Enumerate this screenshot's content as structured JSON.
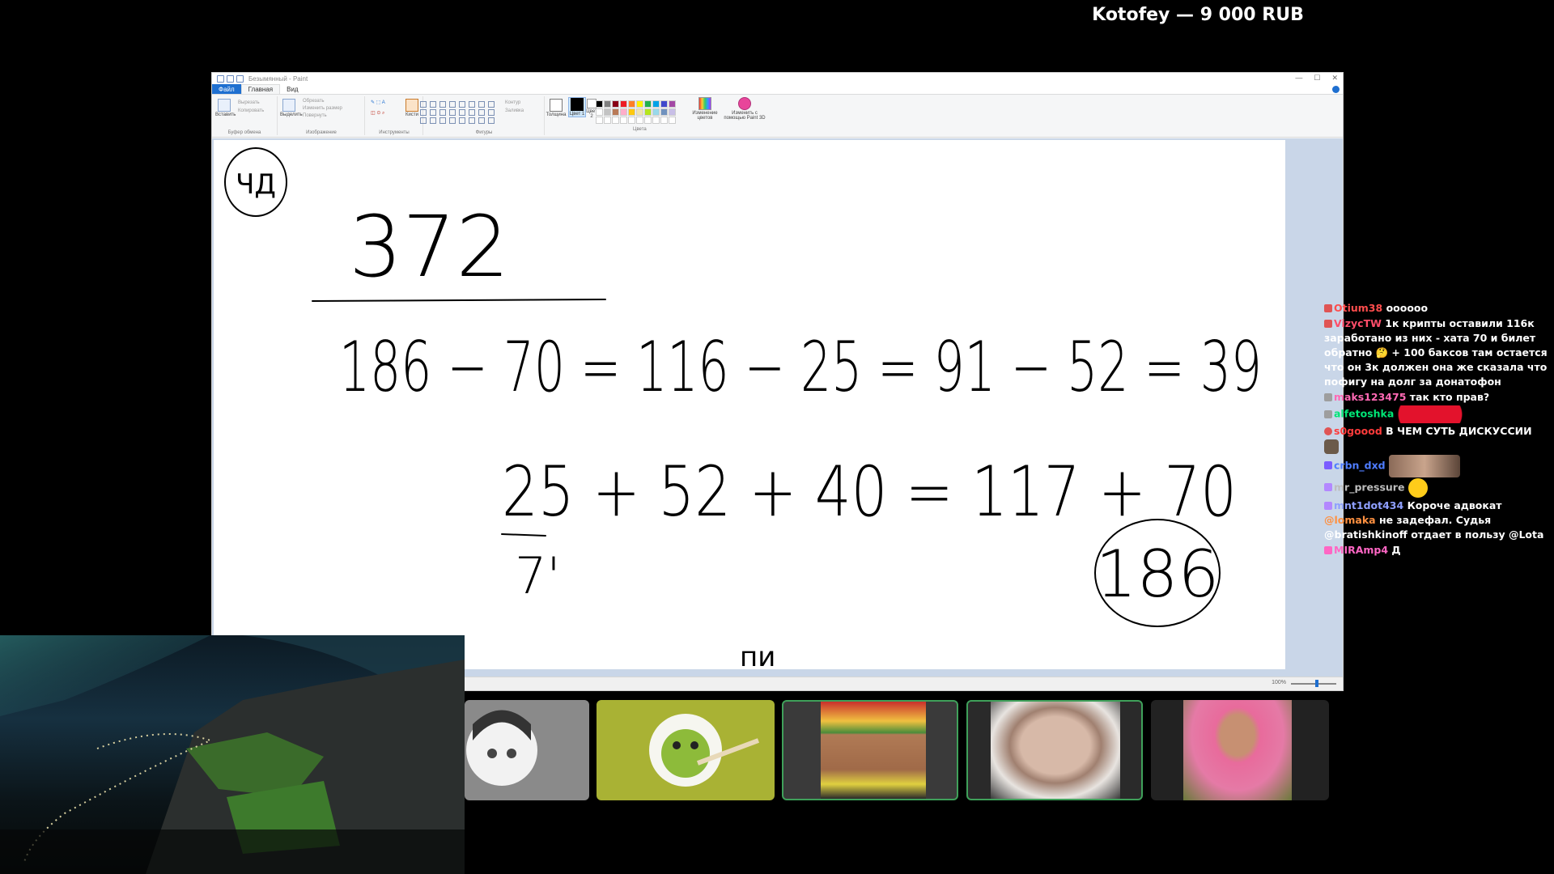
{
  "donation": {
    "text": "Kotofey — 9 000 RUB"
  },
  "paint": {
    "title": "Безымянный - Paint",
    "tabs": {
      "file": "Файл",
      "home": "Главная",
      "view": "Вид"
    },
    "ribbon": {
      "paste": "Вставить",
      "cut": "Вырезать",
      "copy": "Копировать",
      "clipboard": "Буфер обмена",
      "select": "Выделить",
      "crop": "Обрезать",
      "resize": "Изменить размер",
      "rotate": "Повернуть",
      "image": "Изображение",
      "tools": "Инструменты",
      "brushes": "Кисти",
      "shapes": "Фигуры",
      "outline": "Контур",
      "fill": "Заливка",
      "size": "Толщина",
      "color1": "Цвет 1",
      "color2": "Цвет 2",
      "colors": "Цвета",
      "edit_colors": "Изменение цветов",
      "paint3d": "Изменить с помощью Paint 3D"
    },
    "palette": [
      "#000000",
      "#7f7f7f",
      "#880015",
      "#ed1c24",
      "#ff7f27",
      "#fff200",
      "#22b14c",
      "#00a2e8",
      "#3f48cc",
      "#a349a4",
      "#ffffff",
      "#c3c3c3",
      "#b97a57",
      "#ffaec9",
      "#ffc90e",
      "#efe4b0",
      "#b5e61d",
      "#99d9ea",
      "#7092be",
      "#c8bfe7",
      "#ffffff",
      "#ffffff",
      "#ffffff",
      "#ffffff",
      "#ffffff",
      "#ffffff",
      "#ffffff",
      "#ffffff",
      "#ffffff",
      "#ffffff"
    ],
    "zoom": "100%",
    "drawing": {
      "circled_top": "ЧД",
      "numerator": "372",
      "equation1": "186 − 70 = 116 − 25 = 91 − 52 = 39",
      "equation2": "25 + 52 + 40 = 117 + 70",
      "circled_result": "186",
      "under_25": "7'",
      "bottom_text": "пи"
    }
  },
  "chat": {
    "messages": [
      {
        "user": "Otium38",
        "color": "#ff4d4d",
        "text": "oooooo"
      },
      {
        "user": "VizycTW",
        "color": "#ff4d6a",
        "text": "1к крипты оставили 116к заработано из них - хата 70 и билет обратно 🤔 + 100 баксов там остается что он 3к должен она же сказала что пофигу на долг за донатофон"
      },
      {
        "user": "maks123475",
        "color": "#ff69b4",
        "text": "так кто прав?"
      },
      {
        "user": "alfetoshka",
        "color": "#00e676",
        "text": ""
      },
      {
        "user": "s0goood",
        "color": "#ff3b3b",
        "text": "В ЧЕМ СУТЬ ДИСКУССИИ"
      },
      {
        "user": "crbn_dxd",
        "color": "#4f7dff",
        "text": ""
      },
      {
        "user": "mr_pressure",
        "color": "#bdbdbd",
        "text": ""
      },
      {
        "user": "mnt1dot434",
        "color": "#8fa0ff",
        "text": "Короче адвокат"
      },
      {
        "user": "@lomaka",
        "color": "#ff9040",
        "text": "не задефал. Судья @bratishkinoff отдает в пользу @Lota"
      },
      {
        "user": "MIRAmp4",
        "color": "#ff66c4",
        "text": "Д"
      }
    ]
  }
}
